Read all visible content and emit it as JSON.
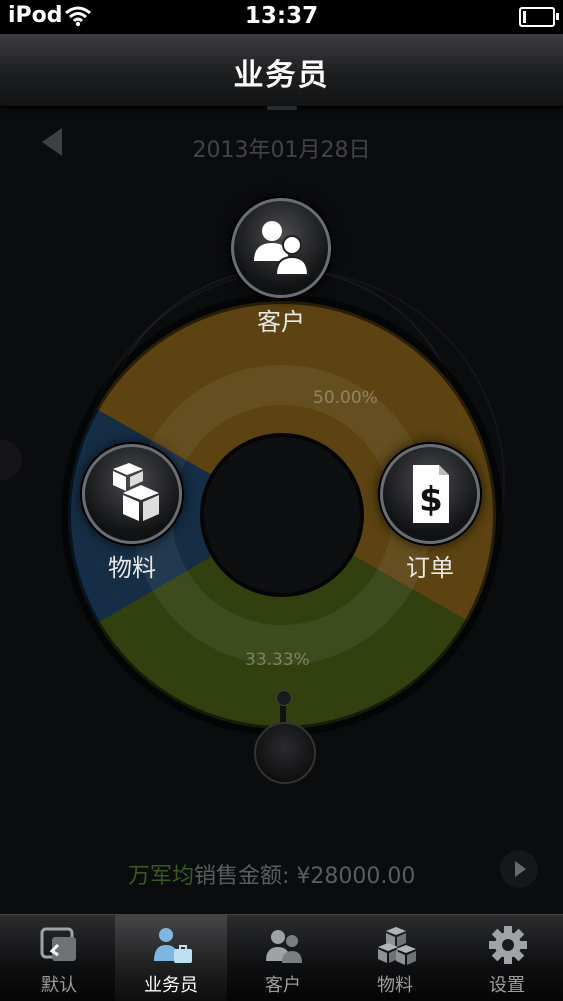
{
  "status_bar": {
    "carrier": "iPod",
    "time": "13:37"
  },
  "nav": {
    "title": "业务员"
  },
  "date_bar": {
    "date": "2013年01月28日"
  },
  "wheel": {
    "nodes": {
      "customer": "客户",
      "material": "物料",
      "order": "订单"
    },
    "percent_top": "50.00%",
    "percent_bottom": "33.33%"
  },
  "chart_data": {
    "type": "pie",
    "categories": [
      "",
      "",
      ""
    ],
    "values": [
      50.0,
      33.33,
      16.67
    ],
    "colors": [
      "#6b4e12",
      "#3a4a10",
      "#17354f"
    ],
    "data_labels": [
      "50.00%",
      "33.33%",
      ""
    ]
  },
  "sales": {
    "name": "万军均",
    "label": "销售金额:",
    "amount": "¥28000.00"
  },
  "tabbar": {
    "tabs": [
      {
        "label": "默认",
        "icon": "default-icon"
      },
      {
        "label": "业务员",
        "icon": "salesperson-icon"
      },
      {
        "label": "客户",
        "icon": "customer-icon"
      },
      {
        "label": "物料",
        "icon": "material-icon"
      },
      {
        "label": "设置",
        "icon": "settings-icon"
      }
    ],
    "active_index": 1
  }
}
